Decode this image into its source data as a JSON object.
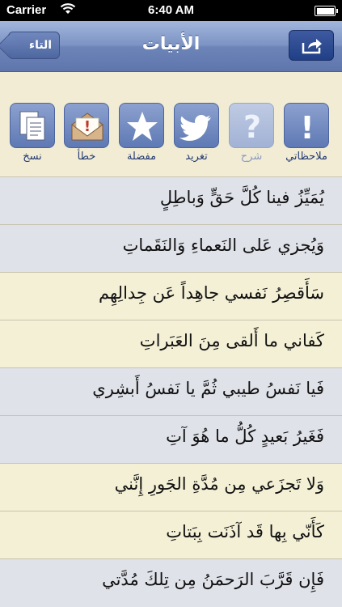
{
  "status": {
    "carrier": "Carrier",
    "time": "6:40 AM"
  },
  "nav": {
    "title": "الأبيات",
    "back_label": "التاء"
  },
  "toolbar": [
    {
      "label": "نسخ",
      "icon": "copy-icon",
      "dim": false
    },
    {
      "label": "خطأ",
      "icon": "report-error-icon",
      "dim": false
    },
    {
      "label": "مفضلة",
      "icon": "star-icon",
      "dim": false
    },
    {
      "label": "تغريد",
      "icon": "twitter-icon",
      "dim": false
    },
    {
      "label": "شرح",
      "icon": "question-icon",
      "dim": true
    },
    {
      "label": "ملاحظاتي",
      "icon": "exclamation-icon",
      "dim": false
    }
  ],
  "verses": [
    {
      "text": "يُمَيِّزُ فينا كُلَّ حَقٍّ وَباطِلٍ",
      "shade": "blue"
    },
    {
      "text": "وَيُجزي عَلى النَعماءِ وَالنَقَماتِ",
      "shade": "blue"
    },
    {
      "text": "سَأَقصِرُ نَفسي جاهِداً عَن جِدالِهِم",
      "shade": "cream"
    },
    {
      "text": "كَفاني ما أَلقى مِنَ العَبَراتِ",
      "shade": "cream"
    },
    {
      "text": "فَيا نَفسُ طيبي ثُمَّ يا نَفسُ أَبشِري",
      "shade": "blue"
    },
    {
      "text": "فَغَيرُ بَعيدٍ كُلُّ ما هُوَ آتِ",
      "shade": "blue"
    },
    {
      "text": "وَلا تَجزَعي مِن مُدَّةِ الجَورِ إِنَّني",
      "shade": "cream"
    },
    {
      "text": "كَأَنّي بِها قَد آذَنَت بِبَتاتِ",
      "shade": "cream"
    },
    {
      "text": "فَإِن قَرَّبَ الرَحمَنُ مِن تِلكَ مُدَّتي",
      "shade": "blue"
    }
  ]
}
